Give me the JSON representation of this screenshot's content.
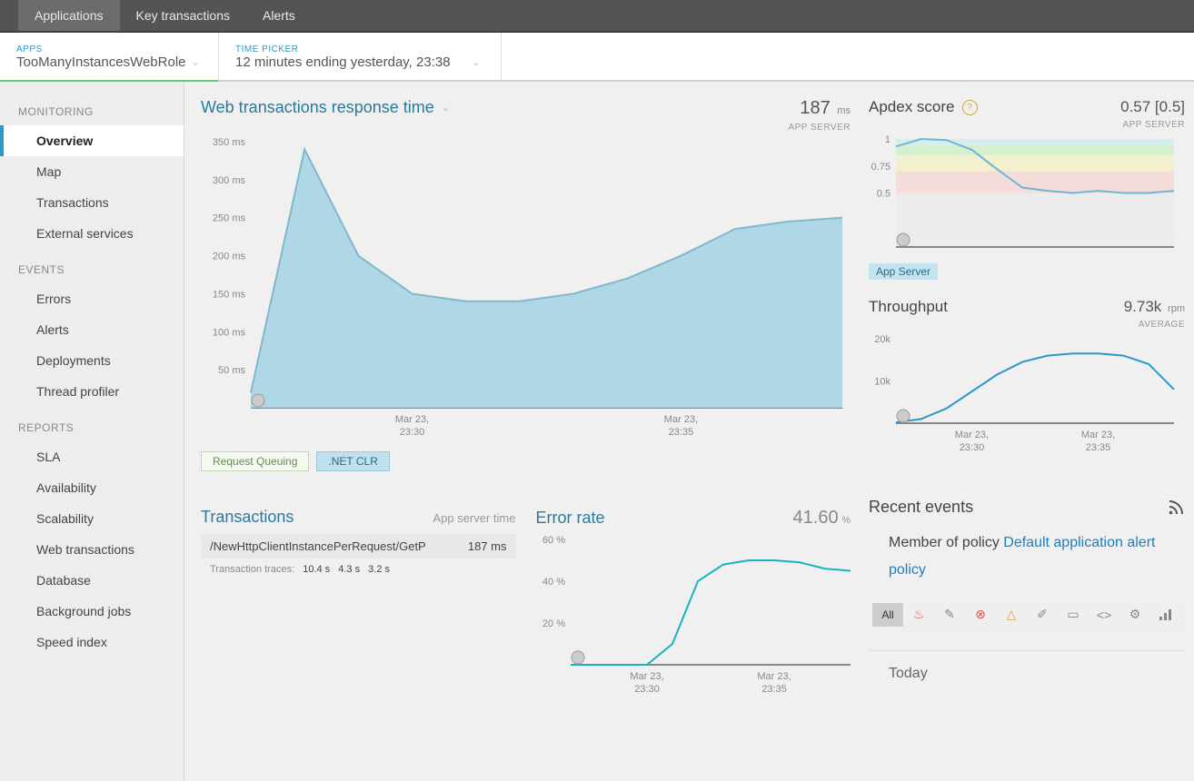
{
  "topbar": {
    "tabs": [
      "Applications",
      "Key transactions",
      "Alerts"
    ],
    "active": 0
  },
  "breadcrumb": {
    "apps": {
      "label": "APPS",
      "value": "TooManyInstancesWebRole"
    },
    "time": {
      "label": "TIME PICKER",
      "value": "12 minutes ending yesterday, 23:38"
    }
  },
  "sidebar": {
    "sections": [
      {
        "title": "MONITORING",
        "items": [
          "Overview",
          "Map",
          "Transactions",
          "External services"
        ],
        "active": 0
      },
      {
        "title": "EVENTS",
        "items": [
          "Errors",
          "Alerts",
          "Deployments",
          "Thread profiler"
        ]
      },
      {
        "title": "REPORTS",
        "items": [
          "SLA",
          "Availability",
          "Scalability",
          "Web transactions",
          "Database",
          "Background jobs",
          "Speed index"
        ]
      }
    ]
  },
  "responseTime": {
    "title": "Web transactions response time",
    "value": "187",
    "unit": "ms",
    "sub": "APP SERVER",
    "legend": [
      "Request Queuing",
      ".NET CLR"
    ]
  },
  "apdex": {
    "title": "Apdex score",
    "value": "0.57 [0.5]",
    "sub": "APP SERVER",
    "pill": "App Server"
  },
  "throughput": {
    "title": "Throughput",
    "value": "9.73k",
    "unit": "rpm",
    "sub": "AVERAGE"
  },
  "transactions": {
    "title": "Transactions",
    "sub": "App server time",
    "row": {
      "name": "/NewHttpClientInstancePerRequest/GetP",
      "time": "187 ms"
    },
    "tracesLabel": "Transaction traces:",
    "traces": [
      "10.4 s",
      "4.3 s",
      "3.2 s"
    ]
  },
  "errorRate": {
    "title": "Error rate",
    "value": "41.60",
    "unit": "%"
  },
  "events": {
    "title": "Recent events",
    "policyPrefix": "Member of policy ",
    "policyLink": "Default application alert policy",
    "filterAll": "All",
    "today": "Today"
  },
  "chart_data": [
    {
      "id": "response_time",
      "type": "area",
      "title": "Web transactions response time",
      "ylabel": "ms",
      "ylim": [
        0,
        350
      ],
      "yticks": [
        50,
        100,
        150,
        200,
        250,
        300,
        350
      ],
      "x": [
        "23:27",
        "23:28",
        "23:29",
        "23:30",
        "23:31",
        "23:32",
        "23:33",
        "23:34",
        "23:35",
        "23:36",
        "23:37",
        "23:38"
      ],
      "xticks": [
        "Mar 23, 23:30",
        "Mar 23, 23:35"
      ],
      "series": [
        {
          "name": ".NET CLR",
          "values": [
            20,
            340,
            200,
            150,
            140,
            140,
            150,
            170,
            200,
            235,
            245,
            250
          ]
        }
      ]
    },
    {
      "id": "apdex",
      "type": "line",
      "title": "Apdex score",
      "ylim": [
        0,
        1
      ],
      "yticks": [
        0.5,
        0.75,
        1
      ],
      "x": [
        "23:27",
        "23:28",
        "23:29",
        "23:30",
        "23:31",
        "23:32",
        "23:33",
        "23:34",
        "23:35",
        "23:36",
        "23:37",
        "23:38"
      ],
      "series": [
        {
          "name": "App Server",
          "values": [
            0.93,
            1.0,
            0.99,
            0.9,
            0.72,
            0.55,
            0.52,
            0.5,
            0.52,
            0.5,
            0.5,
            0.52
          ]
        }
      ],
      "bands": [
        {
          "from": 0.94,
          "to": 1.0,
          "color": "#d4f0ee"
        },
        {
          "from": 0.85,
          "to": 0.94,
          "color": "#d5efcf"
        },
        {
          "from": 0.7,
          "to": 0.85,
          "color": "#f3f0cd"
        },
        {
          "from": 0.5,
          "to": 0.7,
          "color": "#f3dcd9"
        },
        {
          "from": 0.0,
          "to": 0.5,
          "color": "#ececec"
        }
      ]
    },
    {
      "id": "throughput",
      "type": "line",
      "title": "Throughput",
      "ylabel": "rpm",
      "ylim": [
        0,
        20000
      ],
      "yticks": [
        10000,
        20000
      ],
      "ytick_labels": [
        "10k",
        "20k"
      ],
      "x": [
        "23:27",
        "23:28",
        "23:29",
        "23:30",
        "23:31",
        "23:32",
        "23:33",
        "23:34",
        "23:35",
        "23:36",
        "23:37",
        "23:38"
      ],
      "xticks": [
        "Mar 23, 23:30",
        "Mar 23, 23:35"
      ],
      "series": [
        {
          "name": "Throughput",
          "values": [
            200,
            1000,
            3500,
            7500,
            11500,
            14500,
            16000,
            16500,
            16500,
            16000,
            14000,
            8000
          ]
        }
      ]
    },
    {
      "id": "error_rate",
      "type": "line",
      "title": "Error rate",
      "ylabel": "%",
      "ylim": [
        0,
        60
      ],
      "yticks": [
        20,
        40,
        60
      ],
      "x": [
        "23:27",
        "23:28",
        "23:29",
        "23:30",
        "23:31",
        "23:32",
        "23:33",
        "23:34",
        "23:35",
        "23:36",
        "23:37",
        "23:38"
      ],
      "xticks": [
        "Mar 23, 23:30",
        "Mar 23, 23:35"
      ],
      "series": [
        {
          "name": "Error rate",
          "values": [
            0,
            0,
            0,
            0,
            10,
            40,
            48,
            50,
            50,
            49,
            46,
            45
          ]
        }
      ]
    }
  ]
}
